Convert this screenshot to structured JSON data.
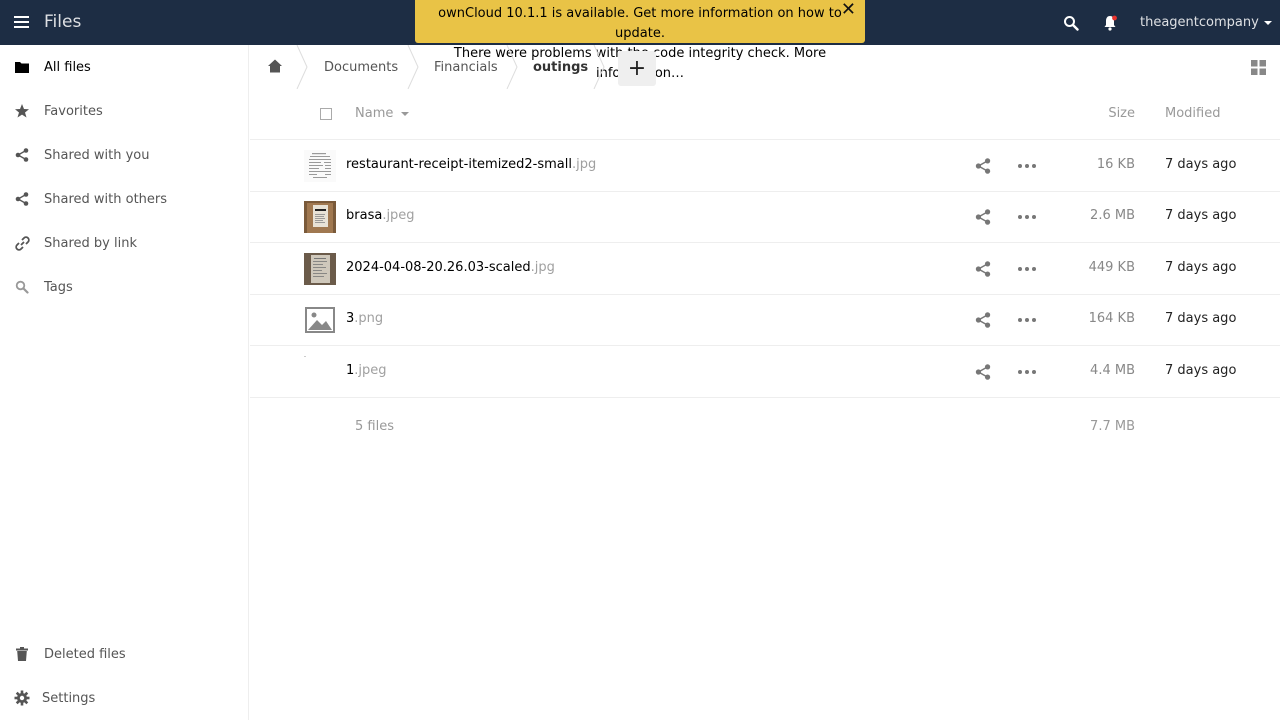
{
  "header": {
    "app_title": "Files",
    "user": "theagentcompany",
    "icons": [
      "menu-icon",
      "search-icon",
      "bell-icon"
    ]
  },
  "notification": {
    "line1": "ownCloud 10.1.1 is available. Get more information on how to update.",
    "line2": "There were problems with the code integrity check. More information…",
    "close": "✕"
  },
  "sidebar": {
    "items": [
      {
        "label": "All files",
        "icon": "folder-icon"
      },
      {
        "label": "Favorites",
        "icon": "star-icon"
      },
      {
        "label": "Shared with you",
        "icon": "share-icon"
      },
      {
        "label": "Shared with others",
        "icon": "share-icon"
      },
      {
        "label": "Shared by link",
        "icon": "link-icon"
      },
      {
        "label": "Tags",
        "icon": "tag-search-icon"
      }
    ],
    "deleted": "Deleted files",
    "settings": "Settings"
  },
  "breadcrumb": {
    "items": [
      "Documents",
      "Financials",
      "outings"
    ],
    "new_button": "+"
  },
  "table": {
    "headers": {
      "name": "Name",
      "size": "Size",
      "modified": "Modified"
    },
    "rows": [
      {
        "base": "restaurant-receipt-itemized2-small",
        "ext": ".jpg",
        "size": "16 KB",
        "modified": "7 days ago",
        "thumb": "receipt-white"
      },
      {
        "base": "brasa",
        "ext": ".jpeg",
        "size": "2.6 MB",
        "modified": "7 days ago",
        "thumb": "photo-brown"
      },
      {
        "base": "2024-04-08-20.26.03-scaled",
        "ext": ".jpg",
        "size": "449 KB",
        "modified": "7 days ago",
        "thumb": "photo-receipt"
      },
      {
        "base": "3",
        "ext": ".png",
        "size": "164 KB",
        "modified": "7 days ago",
        "thumb": "image-placeholder"
      },
      {
        "base": "1",
        "ext": ".jpeg",
        "size": "4.4 MB",
        "modified": "7 days ago",
        "thumb": "blank"
      }
    ],
    "summary": {
      "count": "5 files",
      "total": "7.7 MB"
    }
  },
  "colors": {
    "header_bg": "#1d2d44",
    "notification_bg": "#e9c346"
  }
}
